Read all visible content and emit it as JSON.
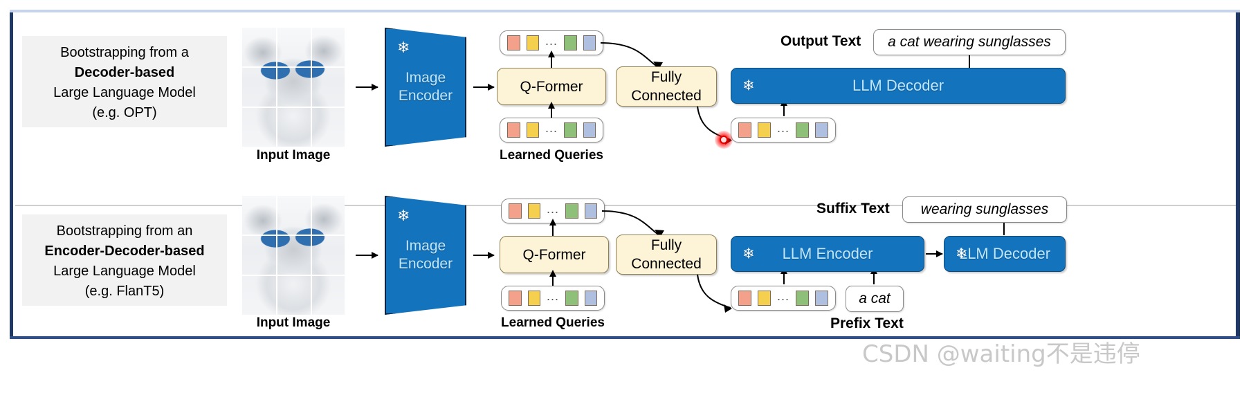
{
  "figure": {
    "watermark": "CSDN @waiting不是违停"
  },
  "rows": [
    {
      "description": {
        "line1": "Bootstrapping from a",
        "line2_bold": "Decoder-based",
        "line3": "Large Language Model",
        "line4": "(e.g. OPT)"
      },
      "image_caption": "Input Image",
      "encoder_label_line1": "Image",
      "encoder_label_line2": "Encoder",
      "qformer_label": "Q-Former",
      "queries_caption": "Learned Queries",
      "fc_label_line1": "Fully",
      "fc_label_line2": "Connected",
      "llm_blocks": [
        {
          "label": "LLM Decoder",
          "frozen": true
        }
      ],
      "text_label": "Output Text",
      "text_value": "a cat wearing sunglasses",
      "tokens": [
        "#f4a18c",
        "#f5d04f",
        "#8fc07a",
        "#aebfe0"
      ],
      "token_dots": "..."
    },
    {
      "description": {
        "line1": "Bootstrapping from an",
        "line2_bold": "Encoder-Decoder-based",
        "line3": "Large Language Model",
        "line4": "(e.g. FlanT5)"
      },
      "image_caption": "Input Image",
      "encoder_label_line1": "Image",
      "encoder_label_line2": "Encoder",
      "qformer_label": "Q-Former",
      "queries_caption": "Learned Queries",
      "fc_label_line1": "Fully",
      "fc_label_line2": "Connected",
      "llm_blocks": [
        {
          "label": "LLM Encoder",
          "frozen": true
        },
        {
          "label": "LLM Decoder",
          "frozen": true
        }
      ],
      "text_label": "Suffix Text",
      "text_value": "wearing sunglasses",
      "prefix_label": "Prefix Text",
      "prefix_value": "a cat",
      "tokens": [
        "#f4a18c",
        "#f5d04f",
        "#8fc07a",
        "#aebfe0"
      ],
      "token_dots": "..."
    }
  ],
  "icons": {
    "snowflake": "❄",
    "frozen_name": "snowflake-frozen-icon"
  },
  "colors": {
    "blue_block": "#1473bd",
    "blue_text": "#bfe7ff",
    "cream_block": "#fdf3d7",
    "panel_border": "#1f3864",
    "click_marker": "#e00000",
    "token_1": "#f4a18c",
    "token_2": "#f5d04f",
    "token_3": "#8fc07a",
    "token_4": "#aebfe0"
  }
}
